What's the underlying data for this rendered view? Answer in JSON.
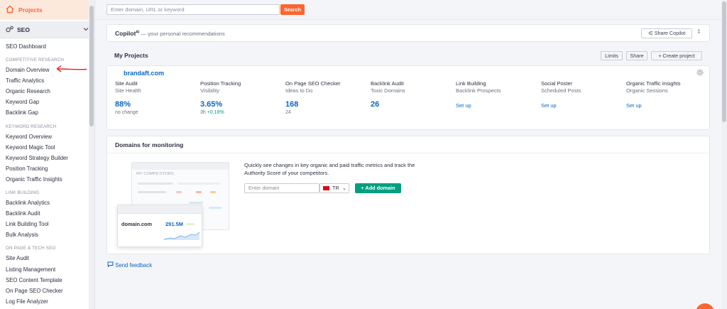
{
  "sidebar": {
    "projects_label": "Projects",
    "seo_label": "SEO",
    "items": [
      {
        "type": "item",
        "label": "SEO Dashboard"
      },
      {
        "type": "section",
        "label": "COMPETITIVE RESEARCH"
      },
      {
        "type": "item",
        "label": "Domain Overview"
      },
      {
        "type": "item",
        "label": "Traffic Analytics"
      },
      {
        "type": "item",
        "label": "Organic Research"
      },
      {
        "type": "item",
        "label": "Keyword Gap"
      },
      {
        "type": "item",
        "label": "Backlink Gap"
      },
      {
        "type": "section",
        "label": "KEYWORD RESEARCH"
      },
      {
        "type": "item",
        "label": "Keyword Overview"
      },
      {
        "type": "item",
        "label": "Keyword Magic Tool"
      },
      {
        "type": "item",
        "label": "Keyword Strategy Builder"
      },
      {
        "type": "item",
        "label": "Position Tracking"
      },
      {
        "type": "item",
        "label": "Organic Traffic Insights"
      },
      {
        "type": "section",
        "label": "LINK BUILDING"
      },
      {
        "type": "item",
        "label": "Backlink Analytics"
      },
      {
        "type": "item",
        "label": "Backlink Audit"
      },
      {
        "type": "item",
        "label": "Link Building Tool"
      },
      {
        "type": "item",
        "label": "Bulk Analysis"
      },
      {
        "type": "section",
        "label": "ON PAGE & TECH SEO"
      },
      {
        "type": "item",
        "label": "Site Audit"
      },
      {
        "type": "item",
        "label": "Listing Management"
      },
      {
        "type": "item",
        "label": "SEO Content Template"
      },
      {
        "type": "item",
        "label": "On Page SEO Checker"
      },
      {
        "type": "item",
        "label": "Log File Analyzer"
      }
    ]
  },
  "search": {
    "placeholder": "Enter domain, URL or keyword",
    "button": "Search"
  },
  "copilot": {
    "title": "Copilot",
    "superscript": "AI",
    "subtitle": "— your personal recommendations",
    "share_label": "Share Copilot"
  },
  "projects": {
    "title": "My Projects",
    "limits": "Limits",
    "share": "Share",
    "create": "Create project",
    "domain": "brandaft.com",
    "tools": [
      {
        "title": "Site Audit",
        "sub": "Site Health",
        "value": "88%",
        "note": "no change"
      },
      {
        "title": "Position Tracking",
        "sub": "Visibility",
        "value": "3.65%",
        "note": "3h",
        "delta": "+0.18%"
      },
      {
        "title": "On Page SEO Checker",
        "sub": "Ideas to Do",
        "value": "168",
        "note": "24"
      },
      {
        "title": "Backlink Audit",
        "sub": "Toxic Domains",
        "value": "26"
      },
      {
        "title": "Link Building",
        "sub": "Backlink Prospects",
        "link": "Set up"
      },
      {
        "title": "Social Poster",
        "sub": "Scheduled Posts",
        "link": "Set up"
      },
      {
        "title": "Organic Traffic Insights",
        "sub": "Organic Sessions",
        "link": "Set up"
      }
    ]
  },
  "monitoring": {
    "title": "Domains for monitoring",
    "description_line1": "Quickly see changes in key organic and paid traffic metrics and track the",
    "description_line2": "Authority Score of your competitors.",
    "illustration_caption": "MY COMPETITORS",
    "example_domain": "domain.com",
    "example_value": "291.5M",
    "input_placeholder": "Enter domain",
    "country": "TR",
    "add_button": "Add domain"
  },
  "feedback": "Send feedback",
  "colors": {
    "brand": "#ff642d",
    "link": "#0b66c3",
    "green": "#009f81"
  }
}
